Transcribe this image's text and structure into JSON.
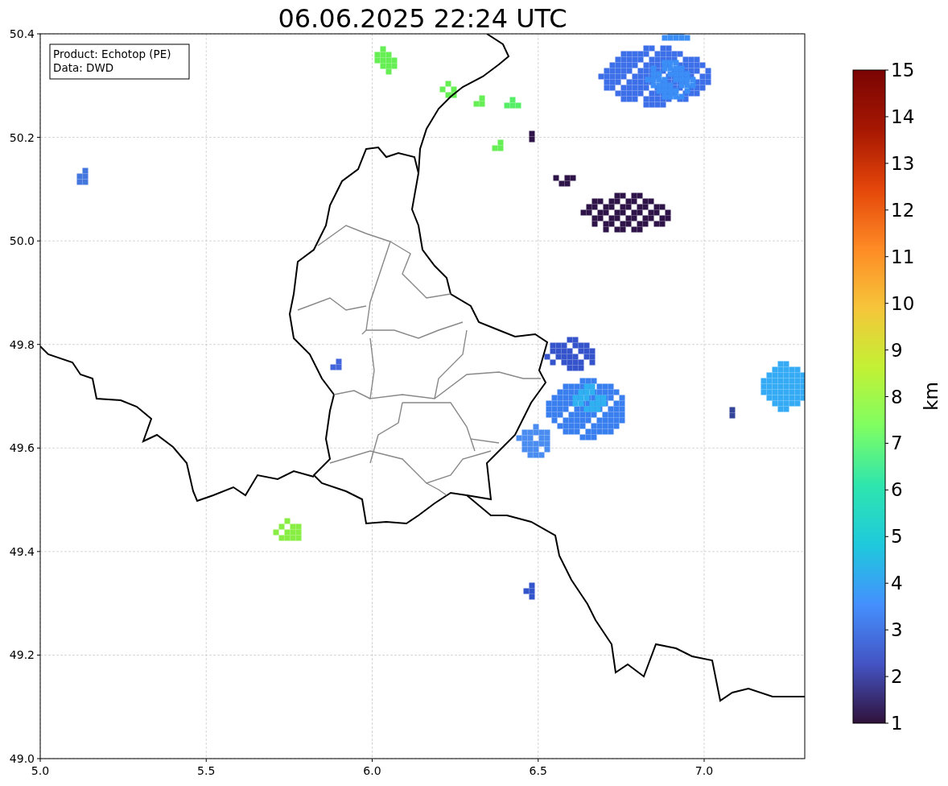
{
  "title": "06.06.2025 22:24 UTC",
  "info_box": {
    "lines": [
      "Product: Echotop (PE)",
      "Data: DWD"
    ]
  },
  "x_ticks": [
    "5.0",
    "5.5",
    "6.0",
    "6.5",
    "7.0"
  ],
  "y_ticks": [
    "50.4",
    "50.2",
    "50.0",
    "49.8",
    "49.6",
    "49.4",
    "49.2",
    "49.0"
  ],
  "colorbar": {
    "label": "km",
    "ticks": [
      "15",
      "14",
      "13",
      "12",
      "11",
      "10",
      "9",
      "8",
      "7",
      "6",
      "5",
      "4",
      "3",
      "2",
      "1"
    ]
  }
}
